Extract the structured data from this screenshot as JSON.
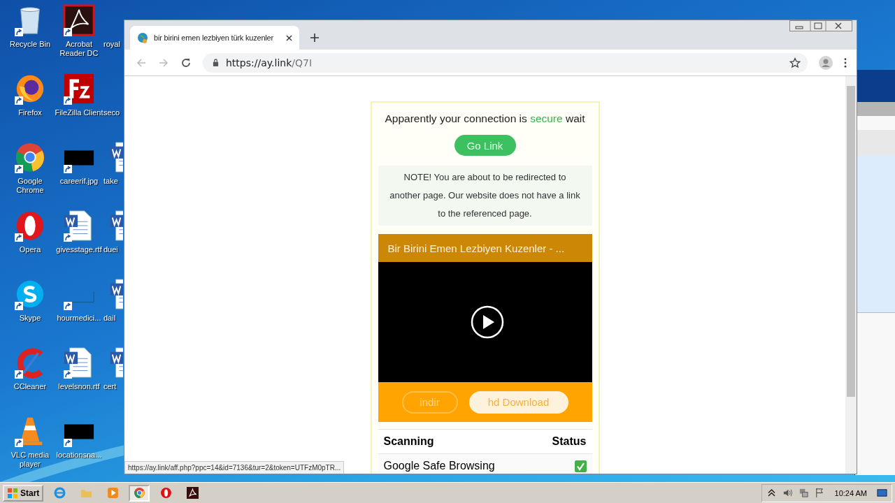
{
  "desktop": {
    "columns": [
      [
        {
          "label": "Recycle Bin",
          "kind": "recycle"
        },
        {
          "label": "Firefox",
          "kind": "firefox"
        },
        {
          "label": "Google Chrome",
          "kind": "chrome"
        },
        {
          "label": "Opera",
          "kind": "opera"
        },
        {
          "label": "Skype",
          "kind": "skype"
        },
        {
          "label": "CCleaner",
          "kind": "ccleaner"
        },
        {
          "label": "VLC media player",
          "kind": "vlc"
        }
      ],
      [
        {
          "label": "Acrobat Reader DC",
          "kind": "acrobat"
        },
        {
          "label": "FileZilla Client",
          "kind": "filezilla"
        },
        {
          "label": "careerif.jpg",
          "kind": "black"
        },
        {
          "label": "givesstage.rtf",
          "kind": "word"
        },
        {
          "label": "hourmedici...",
          "kind": "blank"
        },
        {
          "label": "levelsnon.rtf",
          "kind": "word"
        },
        {
          "label": "locationsna...",
          "kind": "black"
        }
      ],
      [
        {
          "label": "royal",
          "kind": "none"
        },
        {
          "label": "seco",
          "kind": "none"
        },
        {
          "label": "take",
          "kind": "word"
        },
        {
          "label": "duei",
          "kind": "word"
        },
        {
          "label": "dail",
          "kind": "word"
        },
        {
          "label": "cert",
          "kind": "word"
        }
      ]
    ]
  },
  "browser": {
    "tab": {
      "title": "bir birini emen lezbiyen türk kuzenler",
      "selected": true
    },
    "address": {
      "host": "https://ay.link",
      "path": "/Q7I"
    },
    "status_url": "https://ay.link/aff.php?ppc=14&id=7136&tur=2&token=UTFzM0pTR..."
  },
  "page": {
    "intro": "Apparently your connection is",
    "intro_status": "secure",
    "intro_end": "wait",
    "go_button": "Go Link",
    "note": "NOTE! You are about to be redirected to another page. Our website does not have a link to the referenced page.",
    "video": {
      "title": "Bir Birini Emen Lezbiyen Kuzenler - ..."
    },
    "buttons": [
      {
        "label": "indir",
        "kind": "outline"
      },
      {
        "label": "hd Download",
        "kind": "filled"
      }
    ],
    "scan_table": {
      "columns": [
        "Scanning",
        "Status"
      ],
      "rows": [
        {
          "name": "Google Safe Browsing",
          "checked": true
        }
      ]
    }
  },
  "taskbar": {
    "start": "Start",
    "apps": [
      {
        "kind": "ie",
        "selected": false
      },
      {
        "kind": "explorer",
        "selected": false
      },
      {
        "kind": "media",
        "selected": false
      },
      {
        "kind": "chrome",
        "selected": true
      },
      {
        "kind": "opera",
        "selected": false
      },
      {
        "kind": "acrobat",
        "selected": false
      }
    ],
    "clock": "10:24 AM"
  }
}
